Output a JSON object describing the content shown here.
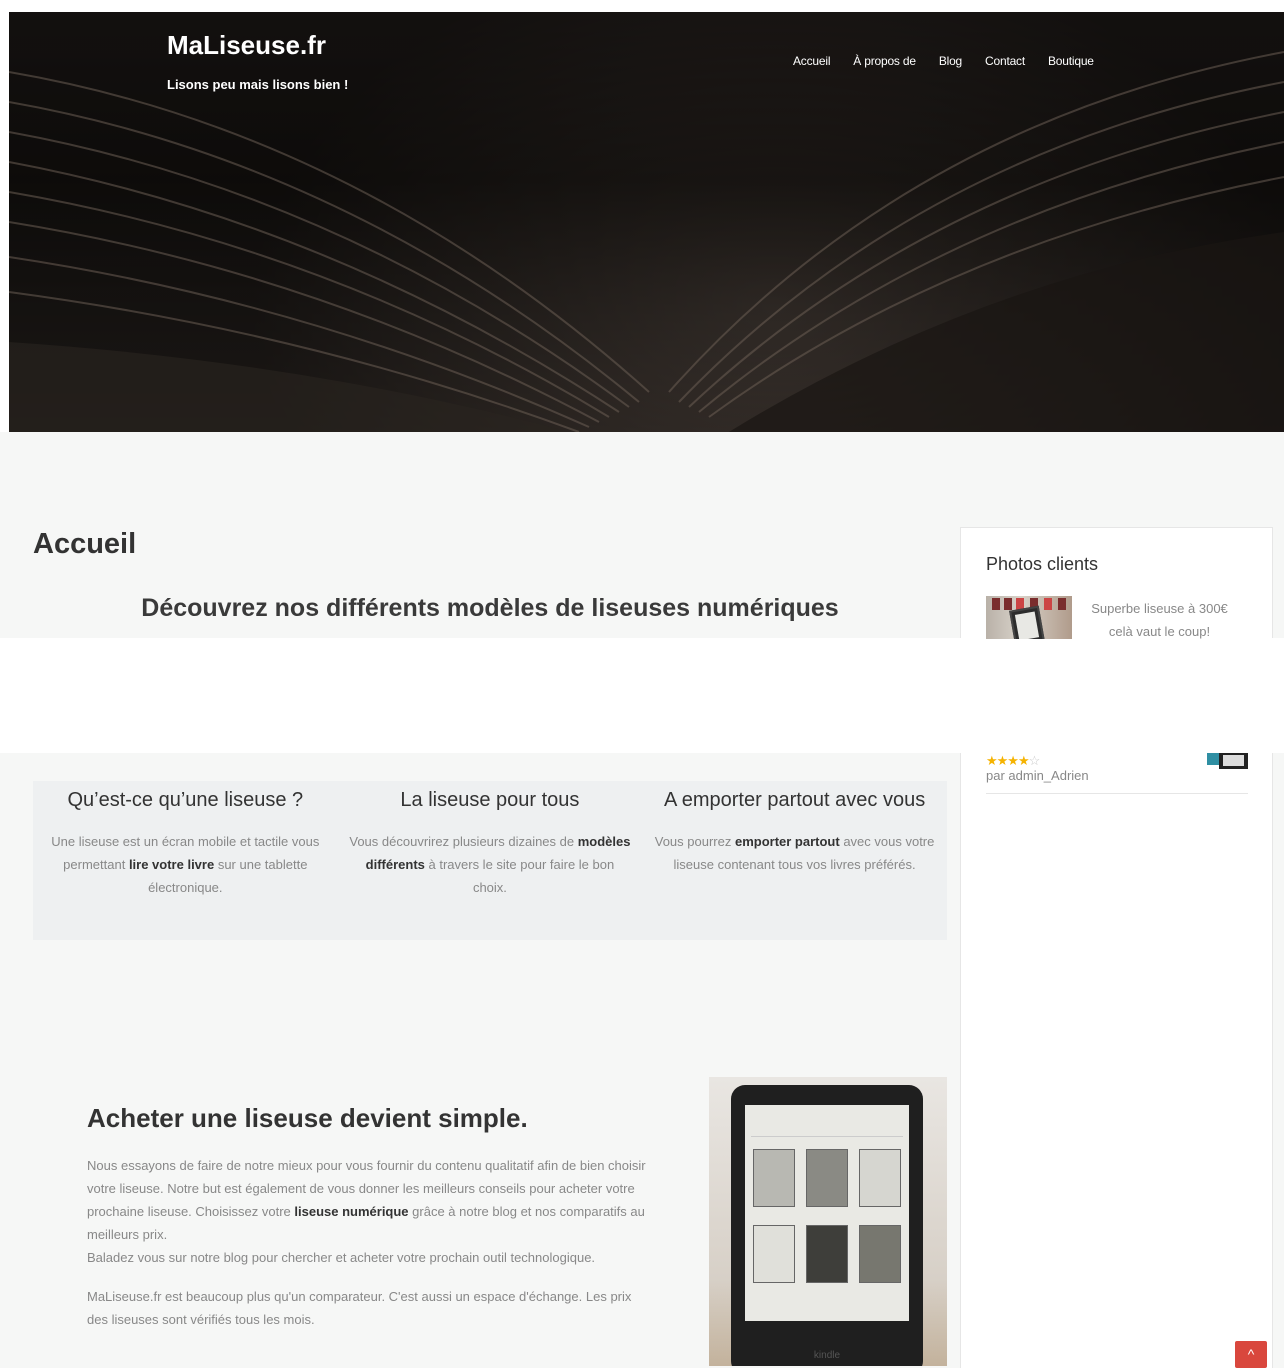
{
  "site": {
    "brand": "MaLiseuse.fr",
    "tagline": "Lisons peu mais lisons bien !"
  },
  "nav": {
    "items": [
      {
        "label": "Accueil"
      },
      {
        "label": "À propos de"
      },
      {
        "label": "Blog"
      },
      {
        "label": "Contact"
      },
      {
        "label": "Boutique"
      }
    ]
  },
  "page": {
    "title": "Accueil",
    "section_heading": "Découvrez nos différents modèles de liseuses numériques"
  },
  "sidebar": {
    "widget_title": "Photos clients",
    "review": {
      "text": "Superbe liseuse à 300€ celà vaut le coup!",
      "rating": 4,
      "rating_max": 5,
      "stars_filled": "★★★★",
      "stars_empty": "☆",
      "byline": "par admin_Adrien"
    }
  },
  "features": [
    {
      "title": "Qu’est-ce qu’une liseuse ?",
      "text_before": "Une liseuse est un écran mobile et tactile vous permettant ",
      "bold": "lire votre livre",
      "text_after": " sur une tablette électronique."
    },
    {
      "title": "La liseuse pour tous",
      "text_before": "Vous découvrirez plusieurs dizaines de ",
      "bold": "modèles différents",
      "text_after": " à travers le site pour faire le bon choix."
    },
    {
      "title": "A emporter partout avec vous",
      "text_before": "Vous pourrez ",
      "bold": "emporter partout",
      "text_after": " avec vous votre liseuse contenant tous vos livres préférés."
    }
  ],
  "about": {
    "heading": "Acheter une liseuse devient simple.",
    "p1_before": "Nous essayons de faire de notre mieux pour vous fournir du contenu qualitatif afin de bien choisir votre liseuse. Notre but est également de vous donner les meilleurs conseils pour acheter votre prochaine liseuse. Choisissez votre ",
    "p1_bold": "liseuse numérique",
    "p1_after": " grâce à notre blog et nos comparatifs au meilleurs prix.",
    "p1_line2": "Baladez vous sur notre blog pour chercher et acheter votre prochain outil technologique.",
    "p2": "MaLiseuse.fr est beaucoup plus qu'un comparateur. C'est aussi un espace d'échange. Les prix des liseuses sont vérifiés tous les mois."
  },
  "kindle": {
    "brand_text": "kindle"
  },
  "scroll_top": {
    "icon": "chevron-up-icon",
    "glyph": "^"
  },
  "colors": {
    "accent": "#d9473d",
    "star": "#f5b301"
  }
}
